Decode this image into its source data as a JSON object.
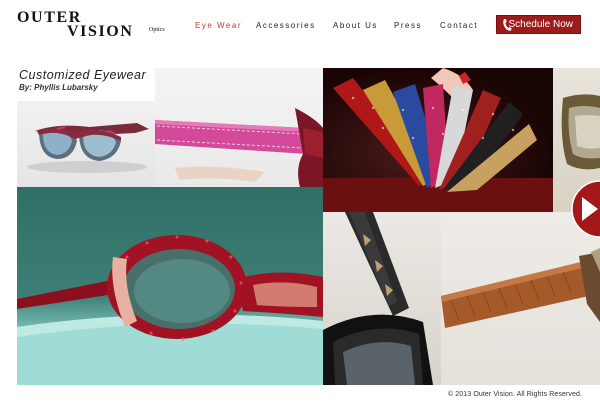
{
  "brand": {
    "line1": "OUTER",
    "line2": "VISION",
    "mark": "Optics"
  },
  "nav": {
    "items": [
      {
        "label": "Eye Wear",
        "active": true
      },
      {
        "label": "Accessories",
        "active": false
      },
      {
        "label": "About Us",
        "active": false
      },
      {
        "label": "Press",
        "active": false
      },
      {
        "label": "Contact",
        "active": false
      }
    ]
  },
  "cta": {
    "label": "Schedule Now",
    "icon": "phone-icon",
    "color": "#9e1b1b"
  },
  "gallery": {
    "title": "Customized  Eyewear",
    "author": "By: Phyllis Lubarsky",
    "next_icon": "play-arrow-icon"
  },
  "footer": {
    "copyright": "© 2013 Outer Vision. All Rights Reserved."
  },
  "colors": {
    "accent": "#c0392b",
    "button": "#9e1b1b"
  }
}
